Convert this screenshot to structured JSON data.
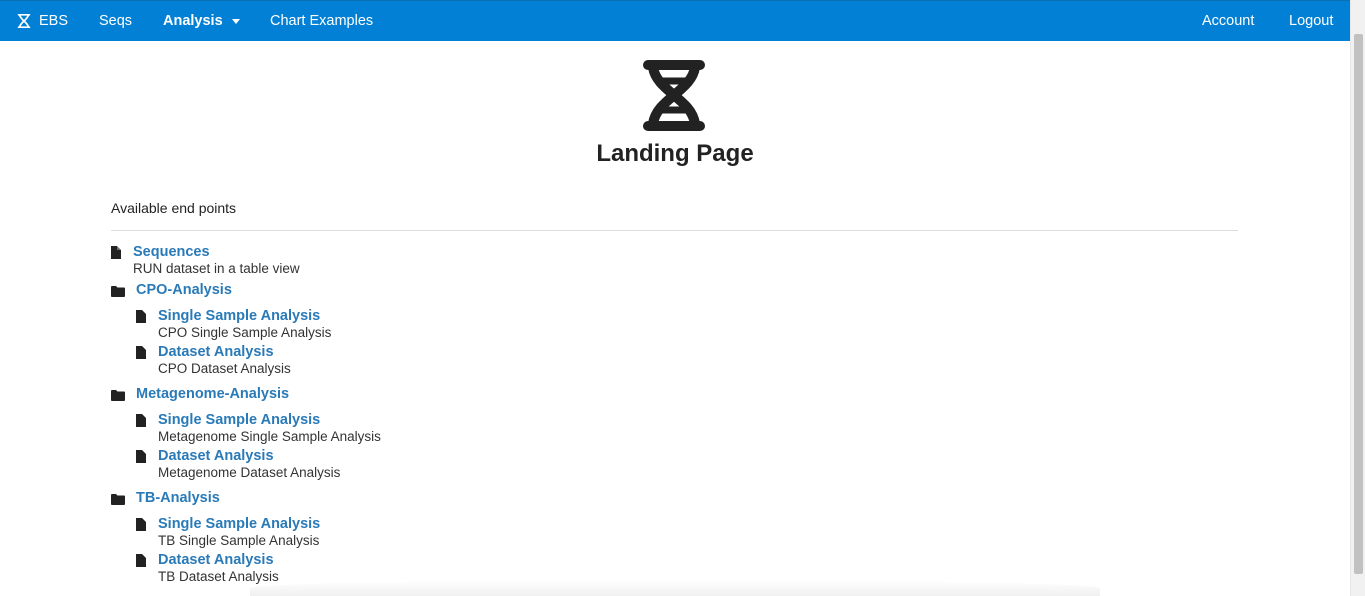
{
  "nav": {
    "brand": "EBS",
    "seqs": "Seqs",
    "analysis": "Analysis",
    "chart_examples": "Chart Examples",
    "account": "Account",
    "logout": "Logout",
    "bar_color": "#0180d5"
  },
  "header": {
    "title": "Landing Page",
    "logo_icon": "dna-icon"
  },
  "endpoints_label": "Available end points",
  "endpoints": {
    "sequences": {
      "label": "Sequences",
      "desc": "RUN dataset in a table view"
    },
    "cpo": {
      "label": "CPO-Analysis",
      "single": {
        "label": "Single Sample Analysis",
        "desc": "CPO Single Sample Analysis"
      },
      "dataset": {
        "label": "Dataset Analysis",
        "desc": "CPO Dataset Analysis"
      }
    },
    "metagenome": {
      "label": "Metagenome-Analysis",
      "single": {
        "label": "Single Sample Analysis",
        "desc": "Metagenome Single Sample Analysis"
      },
      "dataset": {
        "label": "Dataset Analysis",
        "desc": "Metagenome Dataset Analysis"
      }
    },
    "tb": {
      "label": "TB-Analysis",
      "single": {
        "label": "Single Sample Analysis",
        "desc": "TB Single Sample Analysis"
      },
      "dataset": {
        "label": "Dataset Analysis",
        "desc": "TB Dataset Analysis"
      }
    }
  },
  "colors": {
    "link": "#2a7ab8",
    "text": "#333333"
  }
}
